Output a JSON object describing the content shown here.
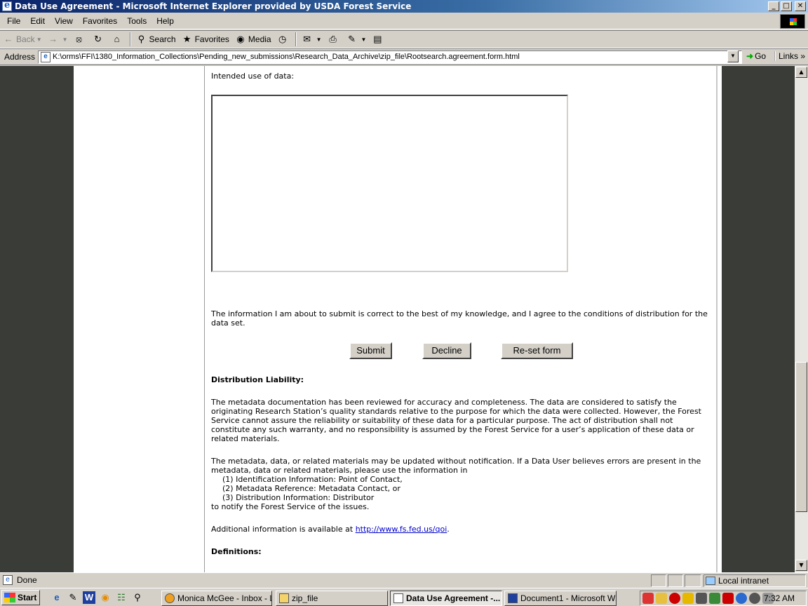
{
  "window": {
    "title": "Data Use Agreement - Microsoft Internet Explorer provided by USDA Forest Service",
    "minimize": "_",
    "maximize": "□",
    "close": "✕"
  },
  "menu": [
    "File",
    "Edit",
    "View",
    "Favorites",
    "Tools",
    "Help"
  ],
  "toolbar": {
    "back": "Back",
    "search": "Search",
    "favorites": "Favorites",
    "media": "Media"
  },
  "address": {
    "label": "Address",
    "url": "K:\\orms\\FFI\\1380_Information_Collections\\Pending_new_submissions\\Research_Data_Archive\\zip_file\\Rootsearch.agreement.form.html",
    "go": "Go",
    "links": "Links"
  },
  "form": {
    "intended_label": "Intended use of data:",
    "intended_value": "",
    "agree_text": "The information I am about to submit is correct to the best of my knowledge, and I agree to the conditions of distribution for the data set.",
    "submit": "Submit",
    "decline": "Decline",
    "reset": "Re-set form"
  },
  "liability": {
    "heading": "Distribution Liability:",
    "p1": "The metadata documentation has been reviewed for accuracy and completeness. The data are considered to satisfy the originating Research Station’s quality standards relative to the purpose for which the data were collected. However, the Forest Service cannot assure the reliability or suitability of these data for a particular purpose. The act of distribution shall not constitute any such warranty, and no responsibility is assumed by the Forest Service for a user’s application of these data or related materials.",
    "p2_intro": "The metadata, data, or related materials may be updated without notification. If a Data User believes errors are present in the metadata, data or related materials, please use the information in",
    "p2_items": [
      "(1) Identification Information: Point of Contact,",
      "(2) Metadata Reference: Metadata Contact, or",
      "(3) Distribution Information: Distributor"
    ],
    "p2_outro": "to notify the Forest Service of the issues.",
    "addl_prefix": "Additional information is available at ",
    "addl_link": "http://www.fs.fed.us/qoi",
    "addl_suffix": ".",
    "definitions_heading": "Definitions:"
  },
  "status": {
    "text": "Done",
    "zone": "Local intranet"
  },
  "taskbar": {
    "start": "Start",
    "tasks": [
      {
        "label": "Monica McGee - Inbox - L...",
        "active": false
      },
      {
        "label": "zip_file",
        "active": false
      },
      {
        "label": "Data Use Agreement -...",
        "active": true
      },
      {
        "label": "Document1 - Microsoft W...",
        "active": false
      }
    ],
    "clock": "7:32 AM"
  },
  "colors": {
    "titlebar_start": "#0a246a",
    "page_background": "#3a3c38",
    "link": "#0000cc"
  }
}
